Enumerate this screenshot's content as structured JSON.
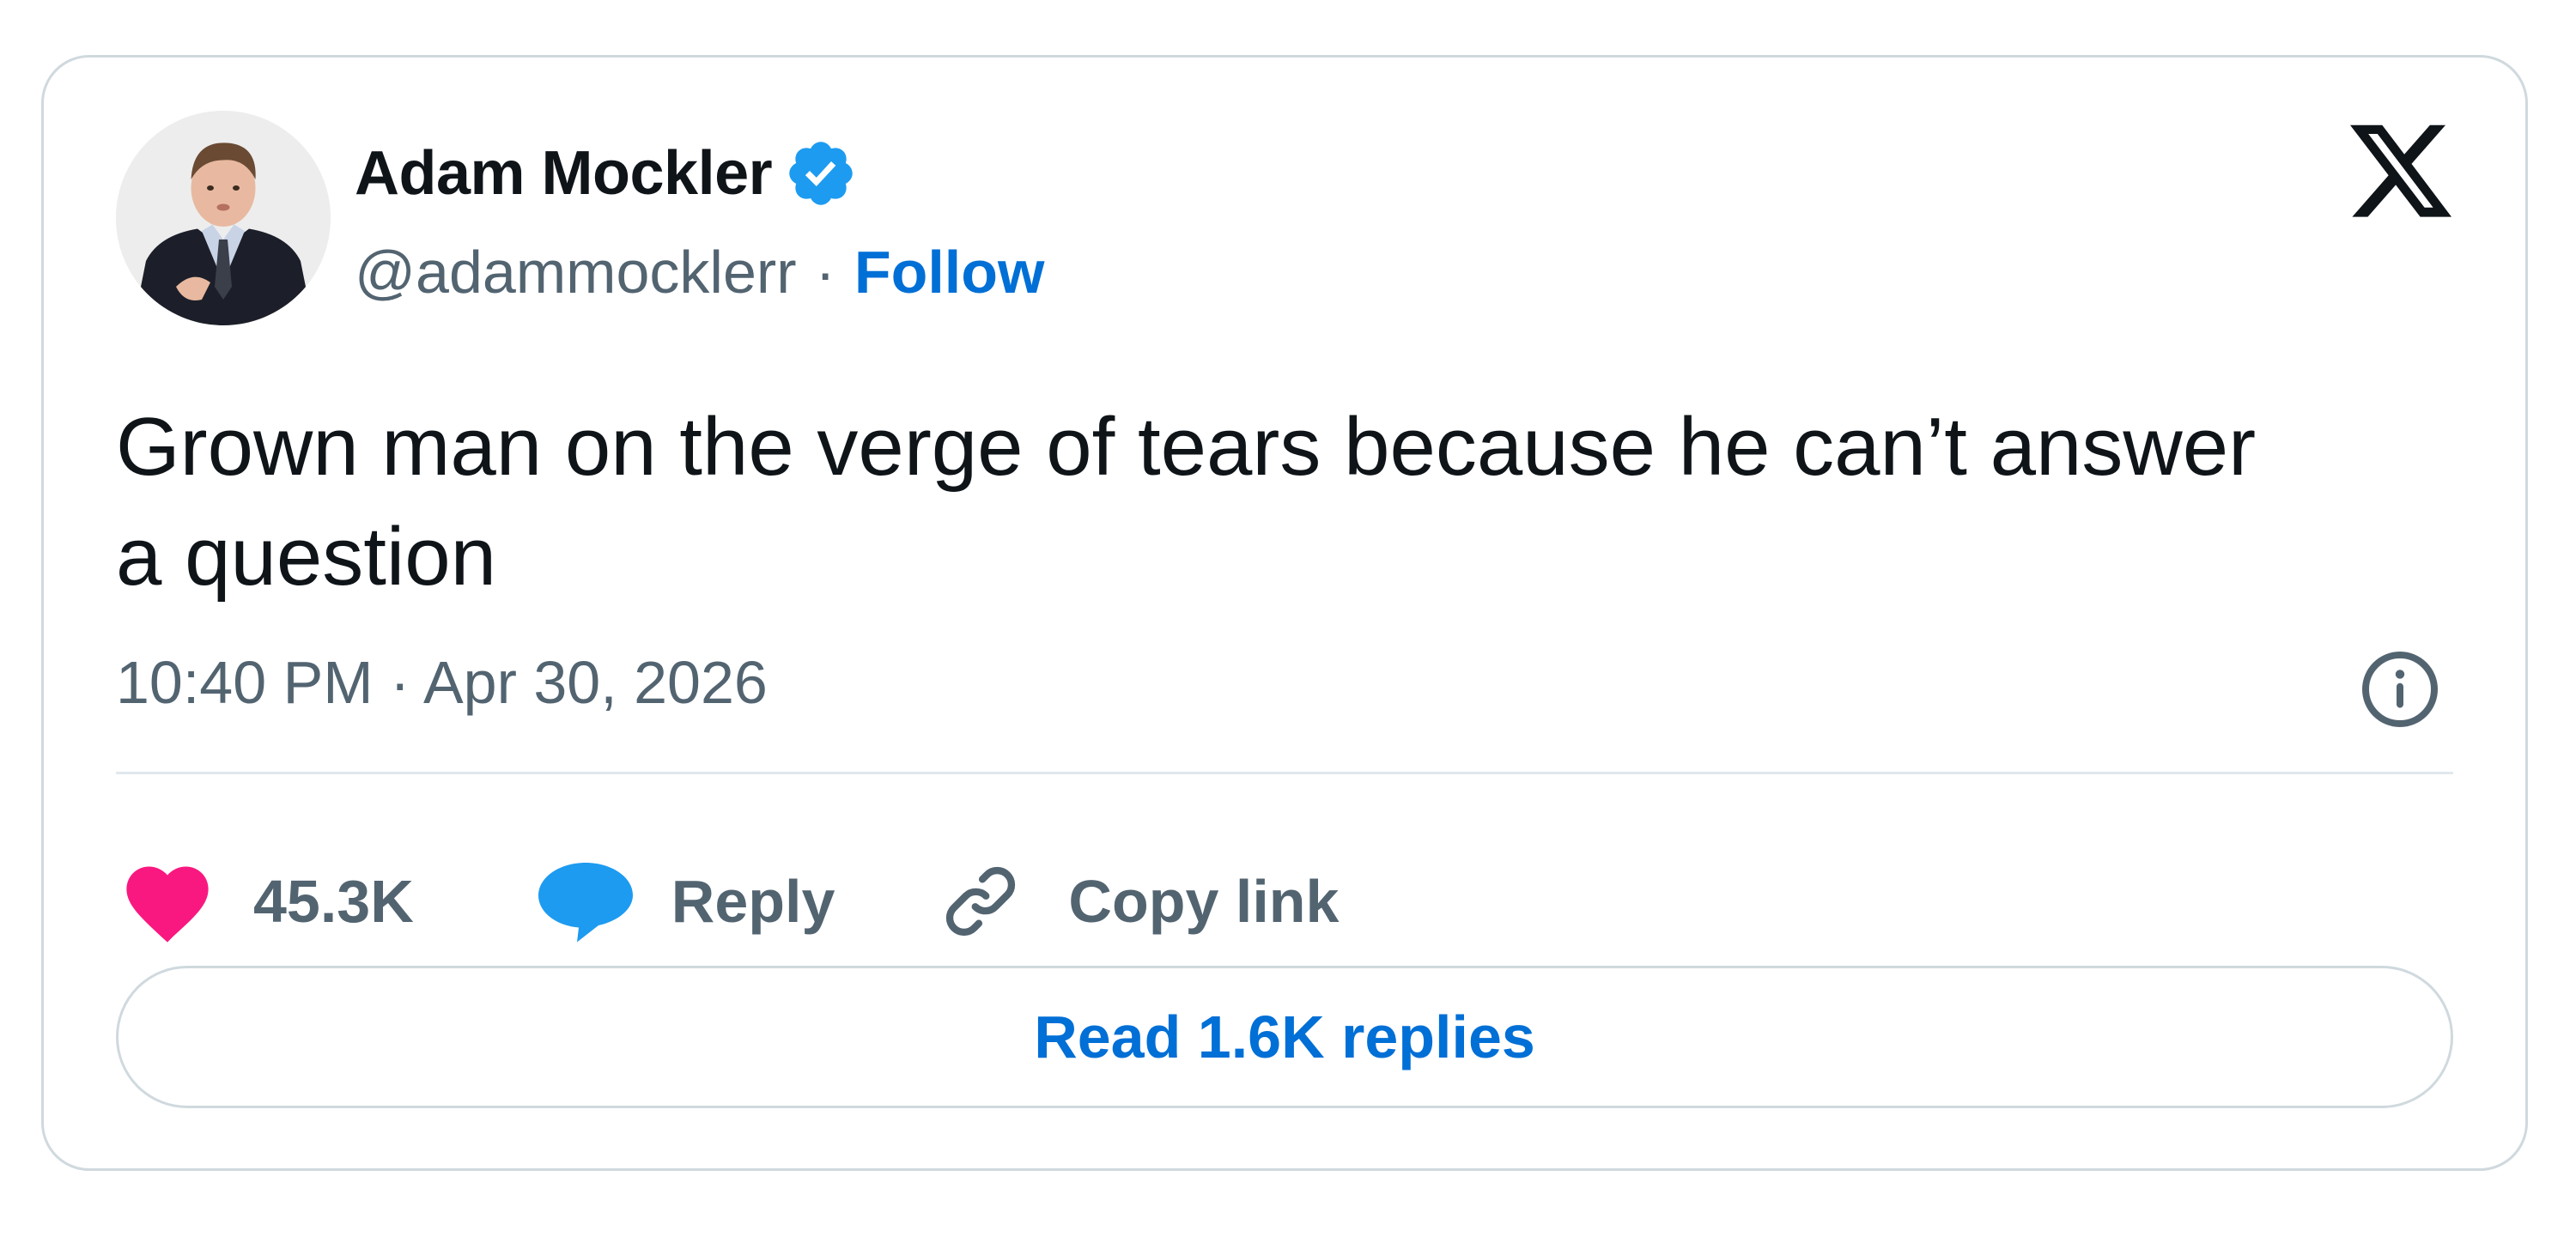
{
  "tweet": {
    "author": {
      "name": "Adam Mockler",
      "handle": "@adammocklerr",
      "verified": true,
      "separator": "·",
      "follow_label": "Follow"
    },
    "text": "Grown man on the verge of tears because he can’t answer\na question",
    "timestamp": "10:40 PM · Apr 30, 2026",
    "actions": {
      "likes": "45.3K",
      "reply_label": "Reply",
      "copy_link_label": "Copy link"
    },
    "read_replies_label": "Read 1.6K replies"
  },
  "icons": {
    "platform_logo": "x-logo-icon",
    "verified": "verified-badge-icon",
    "info": "info-icon",
    "like": "heart-icon",
    "reply": "speech-bubble-icon",
    "copy": "link-icon"
  },
  "colors": {
    "accent_blue": "#006fd6",
    "verified_blue": "#1d9bf0",
    "heart_pink": "#f91880",
    "secondary_text": "#536471",
    "border": "#cfd9de"
  }
}
